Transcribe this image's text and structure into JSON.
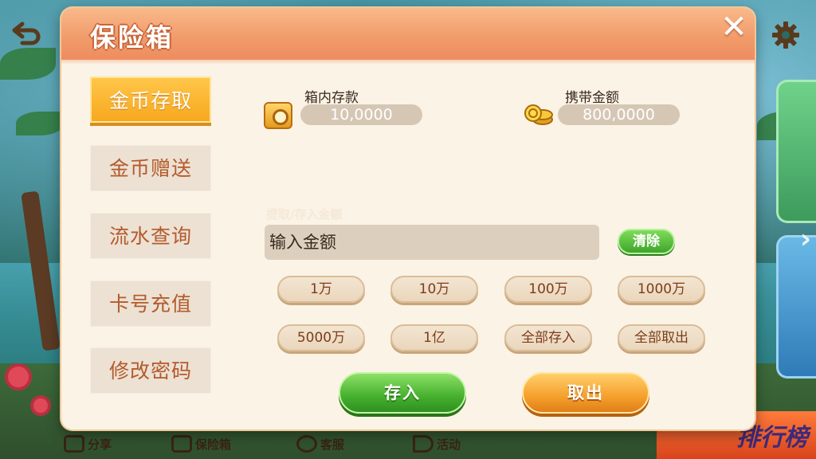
{
  "dialog": {
    "title": "保险箱",
    "close_label": "✕"
  },
  "tabs": [
    {
      "label": "金币存取",
      "active": true
    },
    {
      "label": "金币赠送",
      "active": false
    },
    {
      "label": "流水查询",
      "active": false
    },
    {
      "label": "卡号充值",
      "active": false
    },
    {
      "label": "修改密码",
      "active": false
    }
  ],
  "balances": {
    "safe_label": "箱内存款",
    "safe_value": "10,0000",
    "carry_label": "携带金额",
    "carry_value": "800,0000"
  },
  "amount": {
    "label": "提取/存入金额",
    "placeholder": "输入金额",
    "value": "",
    "clear_label": "清除"
  },
  "quick_amounts": [
    "1万",
    "10万",
    "100万",
    "1000万",
    "5000万",
    "1亿",
    "全部存入",
    "全部取出"
  ],
  "actions": {
    "deposit_label": "存入",
    "withdraw_label": "取出"
  },
  "bottom_nav": [
    "分享",
    "保险箱",
    "客服",
    "活动"
  ],
  "rank_banner": "排行榜",
  "colors": {
    "header": "#f19a6a",
    "tab_active": "#f7a81d",
    "panel": "#fbf3e5",
    "green_button": "#45b02e",
    "orange_button": "#f5a02c"
  }
}
